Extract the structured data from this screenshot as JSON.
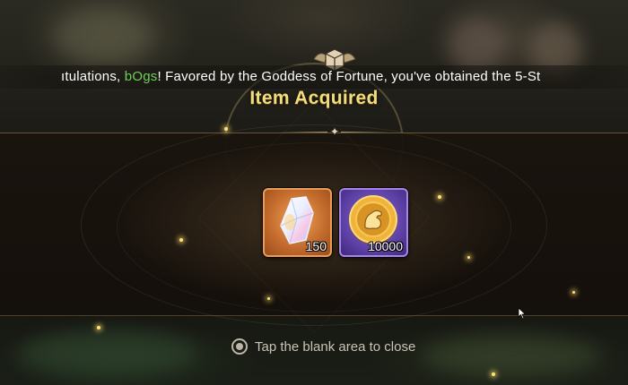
{
  "marquee": {
    "prefix": "ıtulations, ",
    "player_name": "bOgs",
    "suffix": "! Favored by the Goddess of Fortune, you've obtained the 5-St"
  },
  "dialog": {
    "title": "Item Acquired",
    "close_hint": "Tap the blank area to close"
  },
  "rewards": [
    {
      "icon": "crystal-icon",
      "quantity": "150",
      "rarity_color": "#c26a2c"
    },
    {
      "icon": "gold-coin-icon",
      "quantity": "10000",
      "rarity_color": "#5c3fa3"
    }
  ],
  "colors": {
    "title": "#f3dc7a",
    "player_name": "#6fd15a",
    "marquee_text": "#ffffff"
  }
}
